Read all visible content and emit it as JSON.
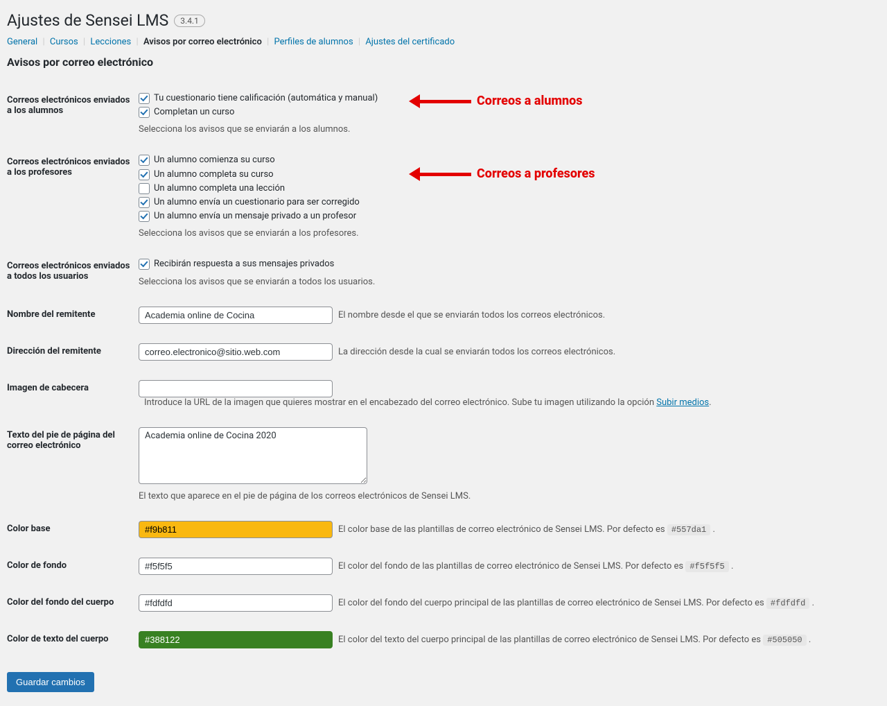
{
  "header": {
    "title": "Ajustes de Sensei LMS",
    "version": "3.4.1"
  },
  "tabs": {
    "general": "General",
    "courses": "Cursos",
    "lessons": "Lecciones",
    "email_notices": "Avisos por correo electrónico",
    "learner_profiles": "Perfiles de alumnos",
    "certificate_settings": "Ajustes del certificado"
  },
  "section_title": "Avisos por correo electrónico",
  "annotations": {
    "students": "Correos a alumnos",
    "teachers": "Correos a profesores"
  },
  "emails_students": {
    "label": "Correos electrónicos enviados a los alumnos",
    "opt_graded": "Tu cuestionario tiene calificación (automática y manual)",
    "opt_complete": "Completan un curso",
    "desc": "Selecciona los avisos que se enviarán a los alumnos."
  },
  "emails_teachers": {
    "label": "Correos electrónicos enviados a los profesores",
    "opt_start": "Un alumno comienza su curso",
    "opt_complete_course": "Un alumno completa su curso",
    "opt_complete_lesson": "Un alumno completa una lección",
    "opt_quiz_submit": "Un alumno envía un cuestionario para ser corregido",
    "opt_private_msg": "Un alumno envía un mensaje privado a un profesor",
    "desc": "Selecciona los avisos que se enviarán a los profesores."
  },
  "emails_all": {
    "label": "Correos electrónicos enviados a todos los usuarios",
    "opt_reply": "Recibirán respuesta a sus mensajes privados",
    "desc": "Selecciona los avisos que se enviarán a todos los usuarios."
  },
  "sender_name": {
    "label": "Nombre del remitente",
    "value": "Academia online de Cocina",
    "help": "El nombre desde el que se enviarán todos los correos electrónicos."
  },
  "sender_address": {
    "label": "Dirección del remitente",
    "value": "correo.electronico@sitio.web.com",
    "help": "La dirección desde la cual se enviarán todos los correos electrónicos."
  },
  "header_image": {
    "label": "Imagen de cabecera",
    "value": "",
    "help_prefix": "Introduce la URL de la imagen que quieres mostrar en el encabezado del correo electrónico. Sube tu imagen utilizando la opción ",
    "link": "Subir medios",
    "help_suffix": "."
  },
  "footer_text": {
    "label": "Texto del pie de página del correo electrónico",
    "value": "Academia online de Cocina 2020",
    "help": "El texto que aparece en el pie de página de los correos electrónicos de Sensei LMS."
  },
  "base_color": {
    "label": "Color base",
    "value": "#f9b811",
    "help": "El color base de las plantillas de correo electrónico de Sensei LMS. Por defecto es ",
    "default": "#557da1"
  },
  "bg_color": {
    "label": "Color de fondo",
    "value": "#f5f5f5",
    "help": "El color del fondo de las plantillas de correo electrónico de Sensei LMS. Por defecto es ",
    "default": "#f5f5f5"
  },
  "body_bg_color": {
    "label": "Color del fondo del cuerpo",
    "value": "#fdfdfd",
    "help": "El color del fondo del cuerpo principal de las plantillas de correo electrónico de Sensei LMS. Por defecto es ",
    "default": "#fdfdfd"
  },
  "body_text_color": {
    "label": "Color de texto del cuerpo",
    "value": "#388122",
    "help": "El color del texto del cuerpo principal de las plantillas de correo electrónico de Sensei LMS. Por defecto es ",
    "default": "#505050"
  },
  "submit": "Guardar cambios"
}
